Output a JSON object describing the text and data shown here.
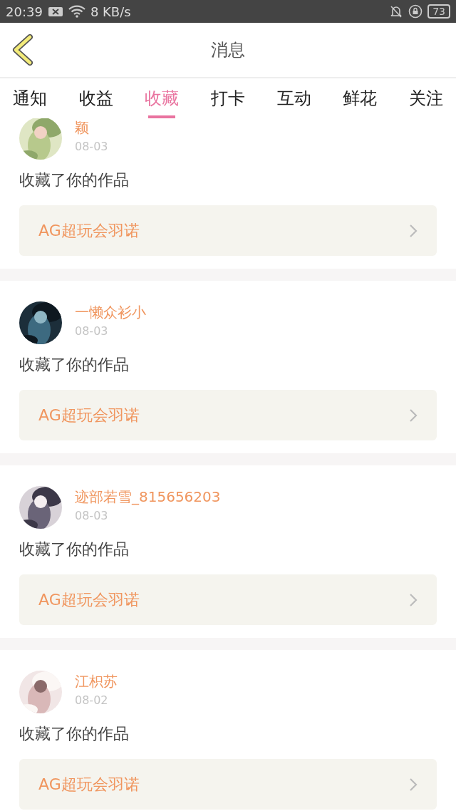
{
  "status_bar": {
    "time": "20:39",
    "speed": "8 KB/s",
    "battery": "73"
  },
  "header": {
    "title": "消息"
  },
  "tabs": [
    {
      "label": "通知",
      "selected": false
    },
    {
      "label": "收益",
      "selected": false
    },
    {
      "label": "收藏",
      "selected": true
    },
    {
      "label": "打卡",
      "selected": false
    },
    {
      "label": "互动",
      "selected": false
    },
    {
      "label": "鲜花",
      "selected": false
    },
    {
      "label": "关注",
      "selected": false
    }
  ],
  "notifications": [
    {
      "user": "颖",
      "date": "08-03",
      "action": "收藏了你的作品",
      "work": "AG超玩会羽诺"
    },
    {
      "user": "一懒众衫小",
      "date": "08-03",
      "action": "收藏了你的作品",
      "work": "AG超玩会羽诺"
    },
    {
      "user": "迹部若雪_815656203",
      "date": "08-03",
      "action": "收藏了你的作品",
      "work": "AG超玩会羽诺"
    },
    {
      "user": "江枳苏",
      "date": "08-02",
      "action": "收藏了你的作品",
      "work": "AG超玩会羽诺"
    }
  ]
}
